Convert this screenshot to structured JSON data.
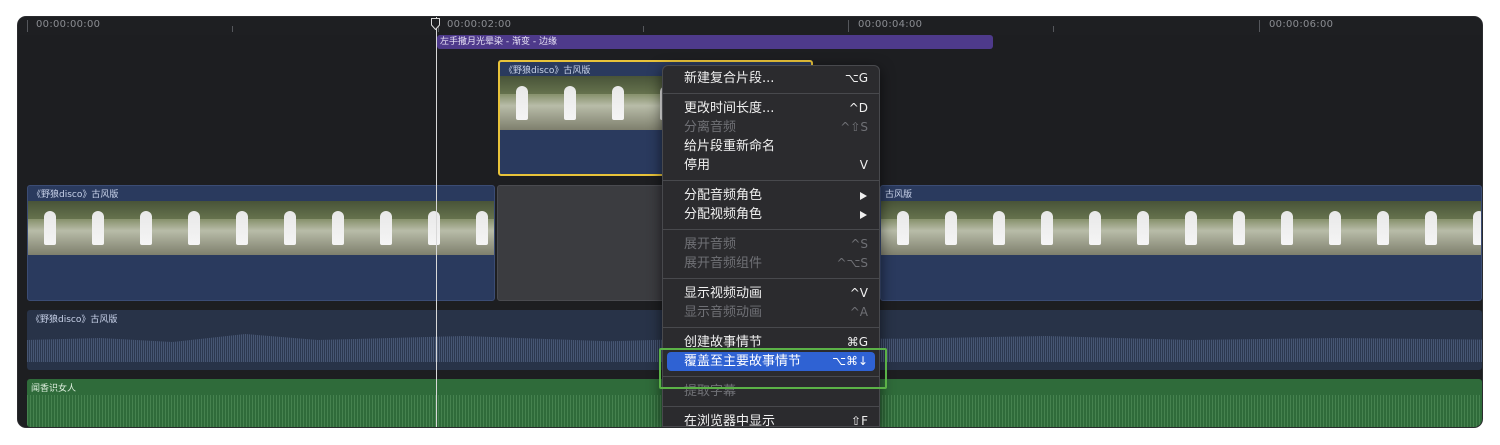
{
  "ruler": {
    "timecodes": [
      "00:00:00:00",
      "00:00:02:00",
      "00:00:04:00",
      "00:00:06:00"
    ]
  },
  "timeline": {
    "transition_label": "左手撒月光晕染 - 渐变 - 边缘",
    "connected_clip_label": "《野狼disco》古风版",
    "primary_clip_left_label": "《野狼disco》古风版",
    "primary_clip_right_label": "古风版",
    "audio_clip_label": "《野狼disco》古风版",
    "music_clip_label": "闻香识女人"
  },
  "context_menu": {
    "items": [
      {
        "label": "新建复合片段...",
        "shortcut": "⌥G",
        "enabled": true
      },
      {
        "label": "更改时间长度...",
        "shortcut": "^D",
        "enabled": true
      },
      {
        "label": "分离音频",
        "shortcut": "^⇧S",
        "enabled": false
      },
      {
        "label": "给片段重新命名",
        "shortcut": "",
        "enabled": true
      },
      {
        "label": "停用",
        "shortcut": "V",
        "enabled": true
      },
      {
        "label": "分配音频角色",
        "shortcut": "",
        "enabled": true,
        "submenu": true
      },
      {
        "label": "分配视频角色",
        "shortcut": "",
        "enabled": true,
        "submenu": true
      },
      {
        "label": "展开音频",
        "shortcut": "^S",
        "enabled": false
      },
      {
        "label": "展开音频组件",
        "shortcut": "^⌥S",
        "enabled": false
      },
      {
        "label": "显示视频动画",
        "shortcut": "^V",
        "enabled": true
      },
      {
        "label": "显示音频动画",
        "shortcut": "^A",
        "enabled": false
      },
      {
        "label": "创建故事情节",
        "shortcut": "⌘G",
        "enabled": true
      },
      {
        "label": "覆盖至主要故事情节",
        "shortcut": "⌥⌘↓",
        "enabled": true,
        "selected": true
      },
      {
        "label": "提取字幕",
        "shortcut": "",
        "enabled": false
      },
      {
        "label": "在浏览器中显示",
        "shortcut": "⇧F",
        "enabled": true
      }
    ]
  },
  "colors": {
    "selection": "#2f62d3",
    "highlight_box": "#5bb247",
    "connected_clip_border": "#e8c33a",
    "transition": "#4e3a8b",
    "music_track": "#2f6b3a"
  }
}
